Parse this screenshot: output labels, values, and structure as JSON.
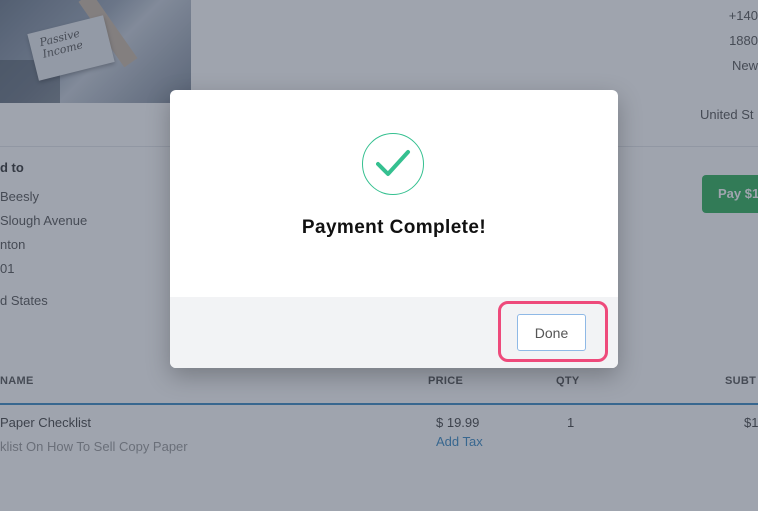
{
  "header": {
    "image_caption": "Passive Income",
    "seller_address_lines": [
      "+140",
      "1880",
      "New"
    ],
    "seller_country": "United St"
  },
  "billing": {
    "title": "d to",
    "lines": [
      "Beesly",
      "Slough Avenue",
      "nton",
      "01",
      "d States"
    ]
  },
  "pay_button": {
    "label": "Pay $1"
  },
  "table": {
    "headers": {
      "name": "NAME",
      "price": "PRICE",
      "qty": "QTY",
      "subtotal": "SUBT"
    },
    "rows": [
      {
        "name": "Paper Checklist",
        "description": "klist On How To Sell Copy Paper",
        "price": "$  19.99",
        "add_tax": "Add Tax",
        "qty": "1",
        "subtotal": "$1"
      }
    ]
  },
  "modal": {
    "title": "Payment Complete!",
    "done_label": "Done",
    "check_color": "#35c090",
    "highlight_color": "#ee4a7b"
  }
}
